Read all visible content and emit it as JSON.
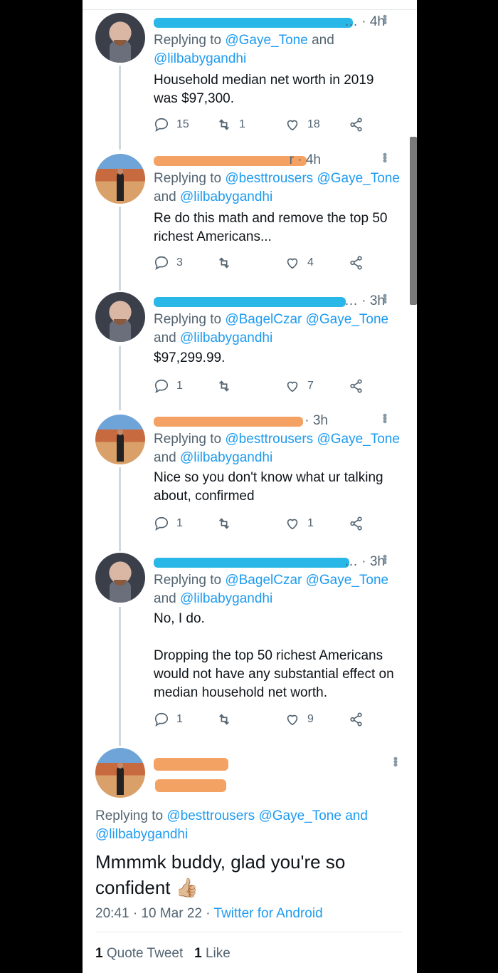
{
  "tweets": [
    {
      "avatar": "man-avatar",
      "time": "… · 4h",
      "replying_prefix": "Replying to ",
      "replying_links": [
        "@Gaye_Tone",
        " and",
        "@lilbabygandhi"
      ],
      "body": [
        "Household median net worth in 2019",
        "was $97,300."
      ],
      "replies": "15",
      "retweets": "1",
      "likes": "18"
    },
    {
      "avatar": "desert-avatar",
      "time": "r · 4h",
      "replying_prefix": "Replying to ",
      "replying_links": [
        "@besttrousers @Gaye_Tone",
        "and",
        "@lilbabygandhi"
      ],
      "body": [
        "Re do this math and remove the top 50",
        "richest Americans..."
      ],
      "replies": "3",
      "retweets": "",
      "likes": "4"
    },
    {
      "avatar": "man-avatar",
      "time": "… · 3h",
      "replying_prefix": "Replying to ",
      "replying_links": [
        "@BagelCzar @Gaye_Tone",
        "and",
        "@lilbabygandhi"
      ],
      "body": [
        "$97,299.99."
      ],
      "replies": "1",
      "retweets": "",
      "likes": "7"
    },
    {
      "avatar": "desert-avatar",
      "time": "· 3h",
      "replying_prefix": "Replying to ",
      "replying_links": [
        "@besttrousers @Gaye_Tone",
        "and",
        "@lilbabygandhi"
      ],
      "body": [
        "Nice so you don't know what ur talking",
        "about, confirmed"
      ],
      "replies": "1",
      "retweets": "",
      "likes": "1"
    },
    {
      "avatar": "man-avatar",
      "time": "… · 3h",
      "replying_prefix": "Replying to ",
      "replying_links": [
        "@BagelCzar @Gaye_Tone",
        "and",
        "@lilbabygandhi"
      ],
      "body": [
        "No, I do.",
        "",
        "Dropping the top 50 richest Americans",
        "would not have any substantial effect on",
        "median household net worth."
      ],
      "replies": "1",
      "retweets": "",
      "likes": "9"
    }
  ],
  "main_tweet": {
    "replying_prefix": "Replying to ",
    "replying_links": [
      "@besttrousers @Gaye_Tone",
      " and",
      "@lilbabygandhi"
    ],
    "text_line1": "Mmmmk buddy, glad you're so",
    "text_line2": "confident 👍🏼",
    "time": "20:41 · 10 Mar 22 · ",
    "source": "Twitter for Android",
    "quote_count": "1",
    "quote_label": "Quote Tweet",
    "like_count": "1",
    "like_label": "Like"
  },
  "colors": {
    "link": "#1d9bf0",
    "muted": "#536471",
    "text": "#0f1419",
    "redact_blue": "#28b7e6",
    "redact_orange": "#f4a264"
  }
}
